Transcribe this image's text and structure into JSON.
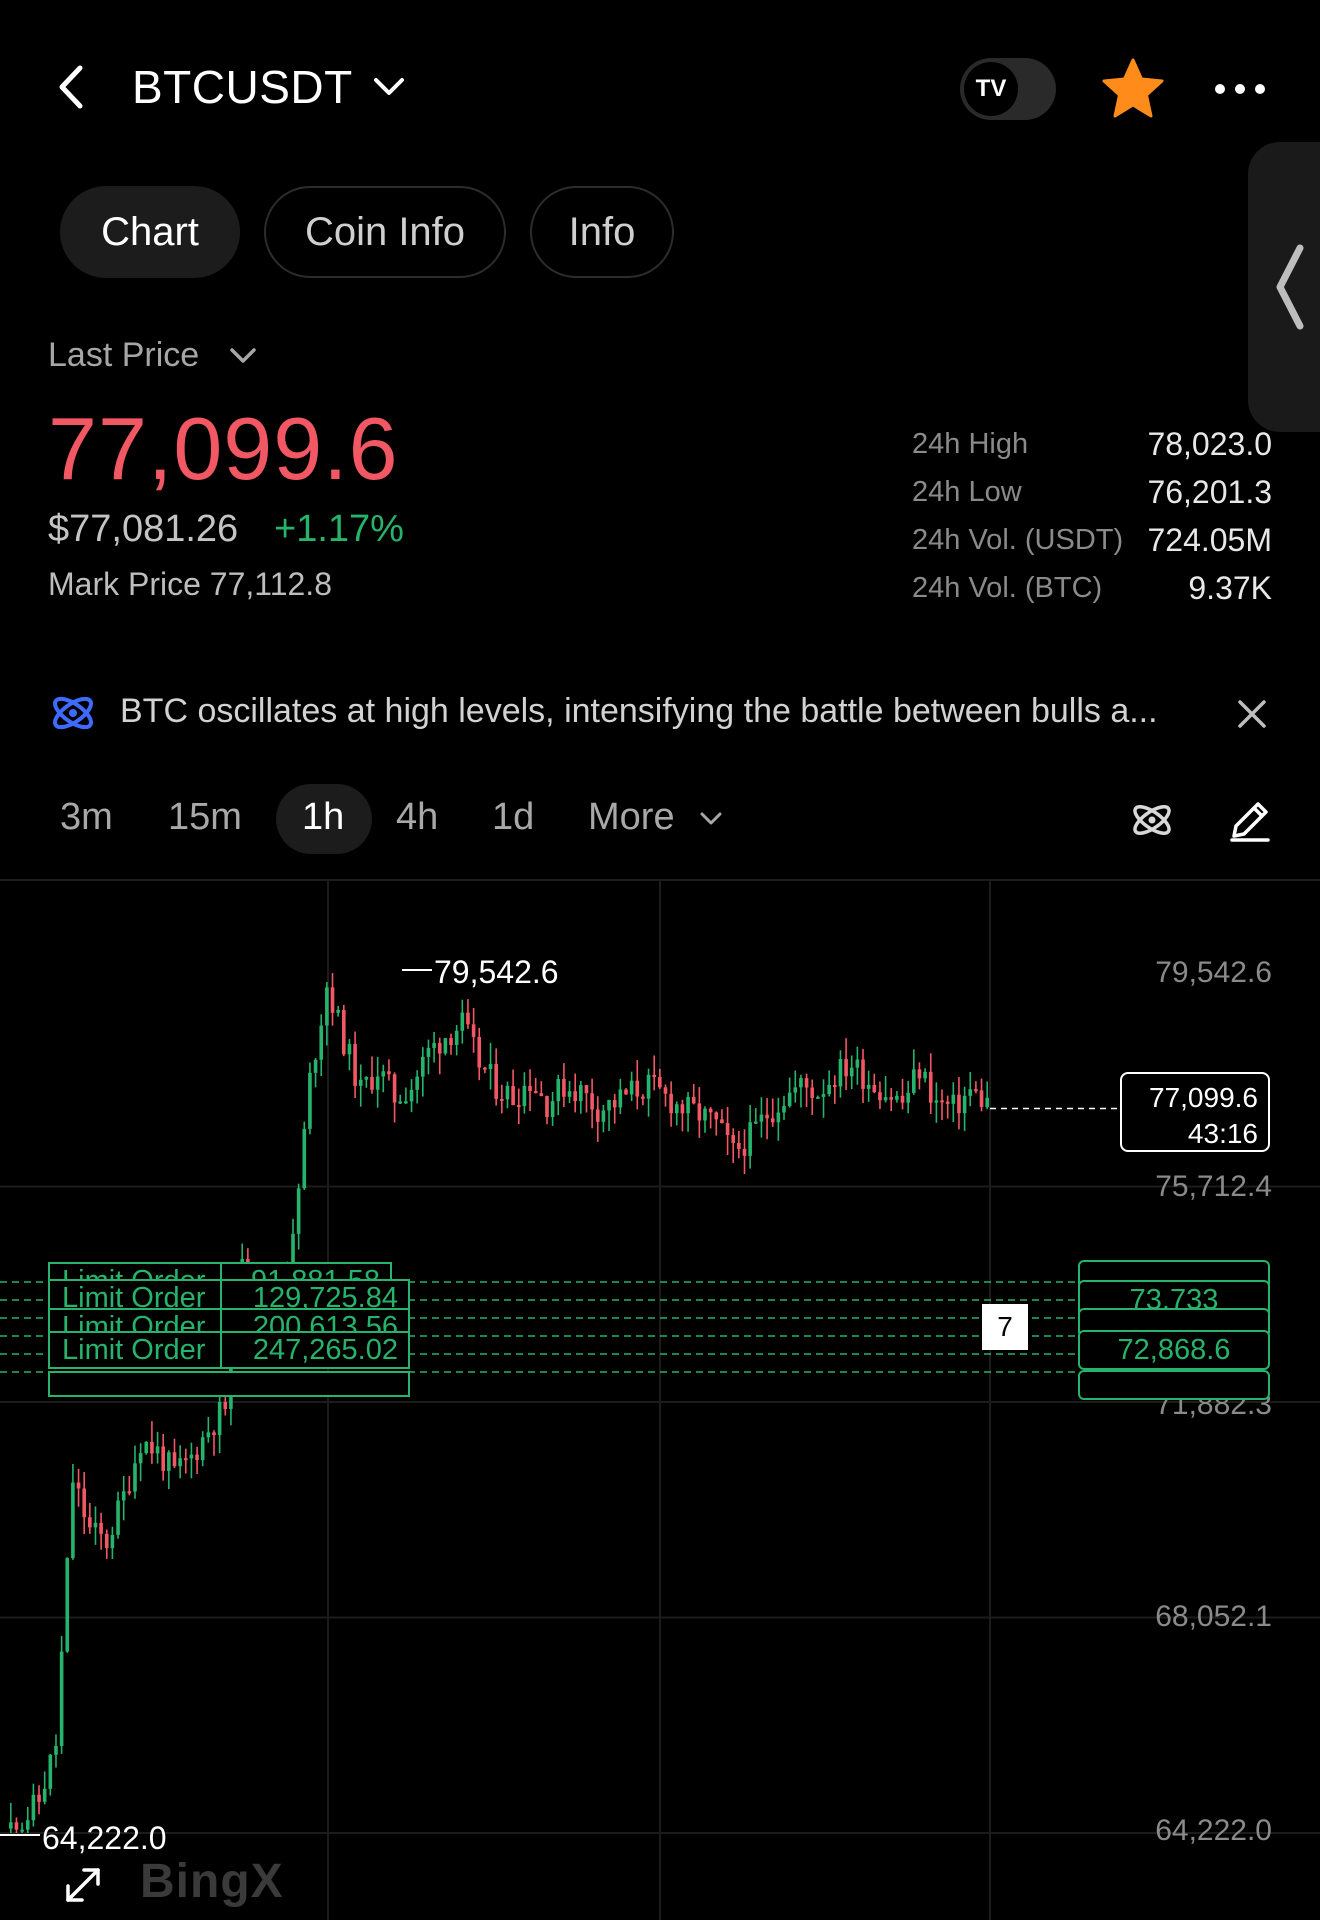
{
  "header": {
    "title": "BTCUSDT",
    "tv_badge": "TV"
  },
  "tabs": [
    "Chart",
    "Coin Info",
    "Info"
  ],
  "price": {
    "label": "Last Price",
    "last": "77,099.6",
    "usd": "$77,081.26",
    "change": "+1.17%",
    "mark": "Mark Price 77,112.8"
  },
  "stats": [
    {
      "label": "24h High",
      "value": "78,023.0"
    },
    {
      "label": "24h Low",
      "value": "76,201.3"
    },
    {
      "label": "24h Vol. (USDT)",
      "value": "724.05M"
    },
    {
      "label": "24h Vol. (BTC)",
      "value": "9.37K"
    }
  ],
  "news": {
    "text": "BTC oscillates at high levels, intensifying the battle between bulls a..."
  },
  "intervals": {
    "items": [
      "3m",
      "15m",
      "1h",
      "4h",
      "1d"
    ],
    "active": "1h",
    "more": "More"
  },
  "chart": {
    "y_axis": [
      "79,542.6",
      "75,712.4",
      "71,882.3",
      "68,052.1",
      "64,222.0"
    ],
    "high_label": "79,542.6",
    "low_label": "64,222.0",
    "last_price": "77,099.6",
    "countdown": "43:16",
    "orders": [
      {
        "type": "Limit Order",
        "amount": "91,881.58"
      },
      {
        "type": "Limit Order",
        "amount": "129,725.84"
      },
      {
        "type": "Limit Order",
        "amount": "200,613.56"
      },
      {
        "type": "Limit Order",
        "amount": "247,265.02"
      }
    ],
    "order_prices": [
      "73,733",
      "72,868.6"
    ],
    "order_count": "7",
    "watermark": "BingX"
  },
  "chart_data": {
    "type": "candlestick",
    "interval": "1h",
    "ylim": [
      62000,
      81000
    ],
    "y_ticks": [
      79542.6,
      75712.4,
      71882.3,
      68052.1,
      64222.0
    ],
    "high": 79542.6,
    "low": 64222.0,
    "last": 77099.6,
    "colors": {
      "up": "#26b36b",
      "down": "#f25764"
    },
    "close_path": [
      64300,
      64400,
      64800,
      65800,
      70500,
      69600,
      69400,
      70200,
      71200,
      71000,
      70600,
      70900,
      71400,
      71800,
      74200,
      73600,
      73800,
      74700,
      77600,
      79300,
      78300,
      77400,
      77800,
      77300,
      77500,
      78100,
      78400,
      78600,
      77900,
      77500,
      77300,
      77600,
      77200,
      77500,
      77400,
      77100,
      77200,
      77400,
      77500,
      77300,
      77100,
      77000,
      76800,
      76300,
      76600,
      77000,
      77300,
      77500,
      77400,
      77700,
      77900,
      77600,
      77400,
      77200,
      77800,
      77200,
      77100,
      77400,
      77200
    ],
    "orders": [
      {
        "type": "Limit Order",
        "amount": 91881.58
      },
      {
        "type": "Limit Order",
        "amount": 129725.84
      },
      {
        "type": "Limit Order",
        "amount": 200613.56
      },
      {
        "type": "Limit Order",
        "amount": 247265.02
      }
    ],
    "order_prices": [
      73733,
      72868.6
    ]
  }
}
